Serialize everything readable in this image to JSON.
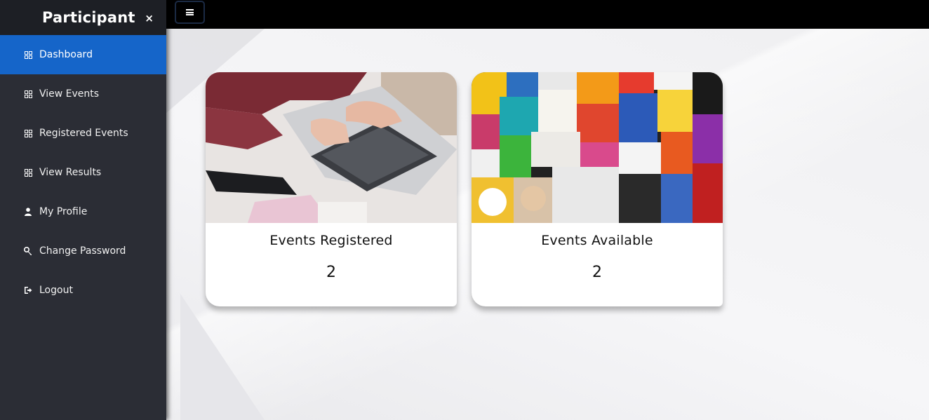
{
  "sidebar": {
    "brand": "Participant",
    "close_label": "×",
    "items": [
      {
        "label": "Dashboard",
        "icon": "grid-icon",
        "active": true
      },
      {
        "label": "View Events",
        "icon": "grid-icon"
      },
      {
        "label": "Registered Events",
        "icon": "grid-icon"
      },
      {
        "label": "View Results",
        "icon": "grid-icon"
      },
      {
        "label": "My Profile",
        "icon": "user-icon"
      },
      {
        "label": "Change Password",
        "icon": "key-icon"
      },
      {
        "label": "Logout",
        "icon": "logout-icon"
      }
    ]
  },
  "topbar": {
    "menu_icon": "hamburger-icon"
  },
  "cards": [
    {
      "title": "Events Registered",
      "count": "2",
      "image": "laptop-photo"
    },
    {
      "title": "Events Available",
      "count": "2",
      "image": "event-posters-photo"
    }
  ],
  "colors": {
    "sidebar_bg": "#2b2d35",
    "active_bg": "#1565c9",
    "topbar_bg": "#000000"
  }
}
